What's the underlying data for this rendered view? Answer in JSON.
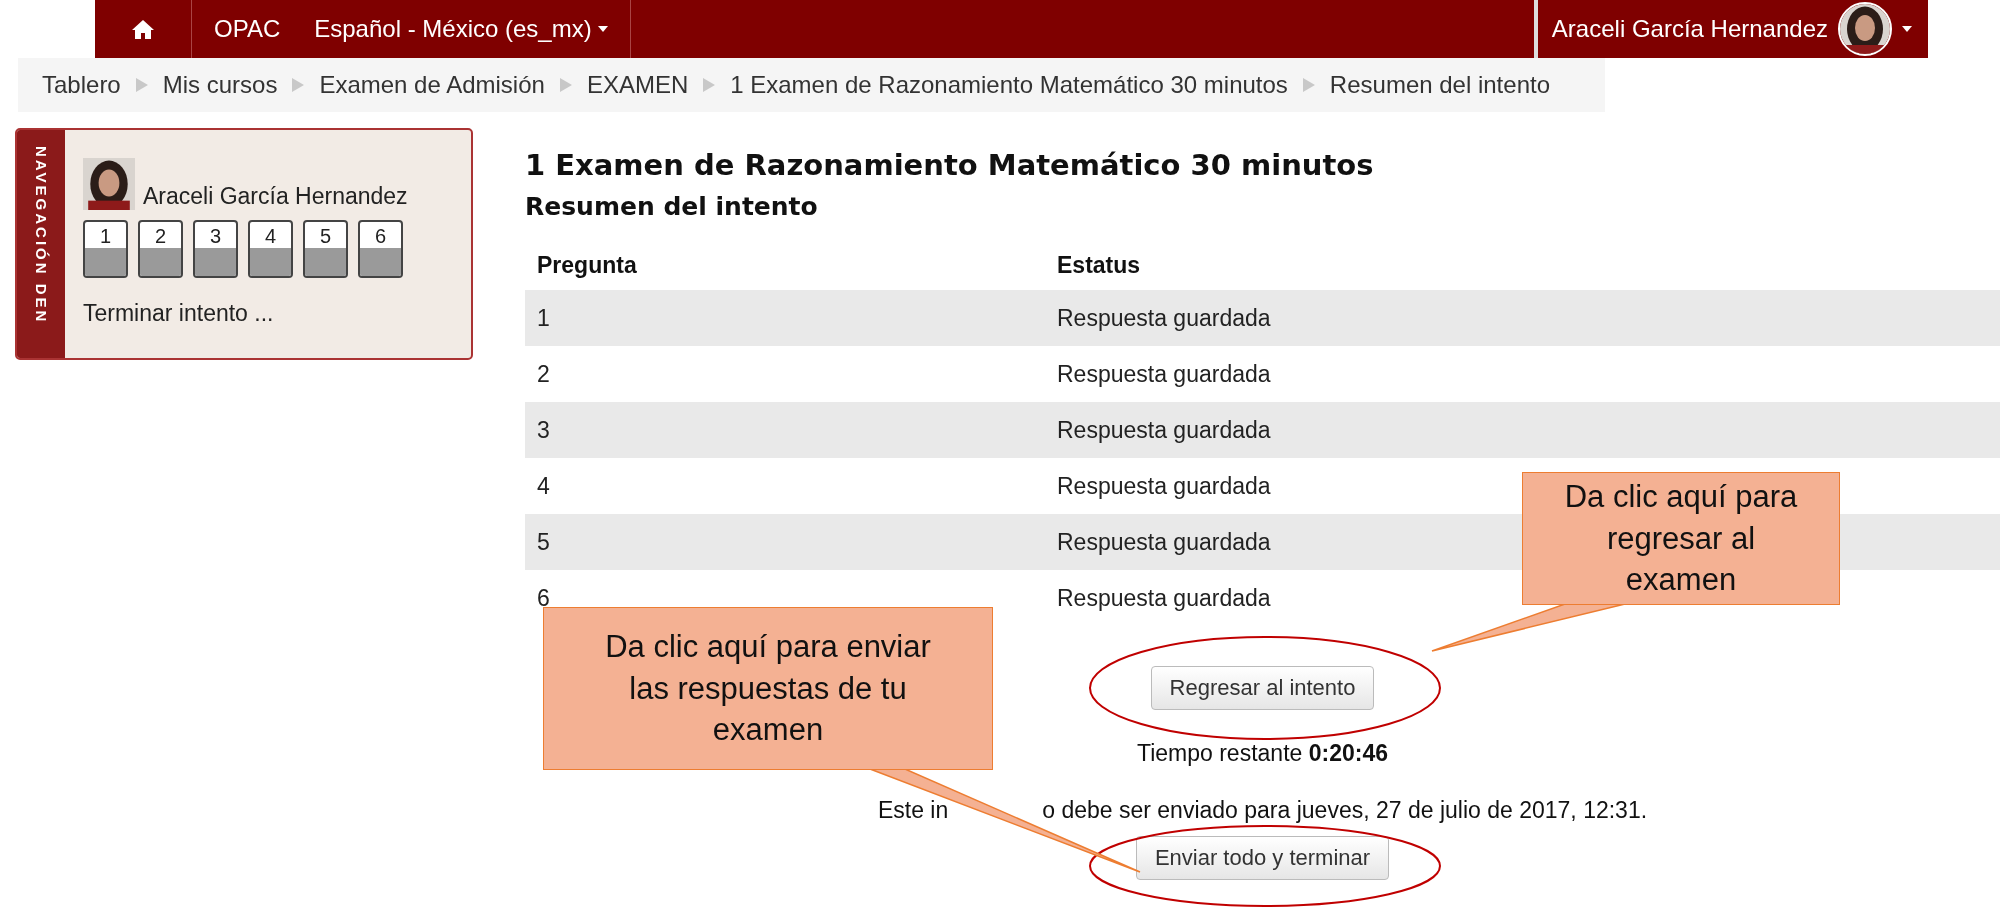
{
  "navbar": {
    "links": [
      {
        "label": "OPAC"
      }
    ],
    "language": "Español - México (es_mx)",
    "user": "Araceli García Hernandez"
  },
  "breadcrumb": [
    "Tablero",
    "Mis cursos",
    "Examen de Admisión",
    "EXAMEN",
    "1 Examen de Razonamiento Matemático 30 minutos",
    "Resumen del intento"
  ],
  "quiz_nav": {
    "title": "NAVEGACIÓN DEN",
    "user": "Araceli García Hernandez",
    "questions": [
      {
        "label": "1",
        "answered": true
      },
      {
        "label": "2",
        "answered": true
      },
      {
        "label": "3",
        "answered": true
      },
      {
        "label": "4",
        "answered": true
      },
      {
        "label": "5",
        "answered": true
      },
      {
        "label": "6",
        "answered": true
      }
    ],
    "finish_link": "Terminar intento ..."
  },
  "title": "1 Examen de Razonamiento Matemático 30 minutos",
  "subtitle": "Resumen del intento",
  "table": {
    "columns": [
      "Pregunta",
      "Estatus"
    ],
    "rows": [
      [
        "1",
        "Respuesta guardada"
      ],
      [
        "2",
        "Respuesta guardada"
      ],
      [
        "3",
        "Respuesta guardada"
      ],
      [
        "4",
        "Respuesta guardada"
      ],
      [
        "5",
        "Respuesta guardada"
      ],
      [
        "6",
        "Respuesta guardada"
      ]
    ]
  },
  "return_button": "Regresar al intento",
  "time_left": "Tiempo restante **0:20:46**",
  "due_text": [
    "Este in",
    "o debe ser enviado para jueves, 27 de julio de 2017, 12:31."
  ],
  "submit_button": "Enviar todo y terminar",
  "callouts": [
    {
      "text": "Da clic aquí para regresar al examen"
    },
    {
      "text": "Da clic aquí para enviar las respuestas de tu examen"
    }
  ]
}
